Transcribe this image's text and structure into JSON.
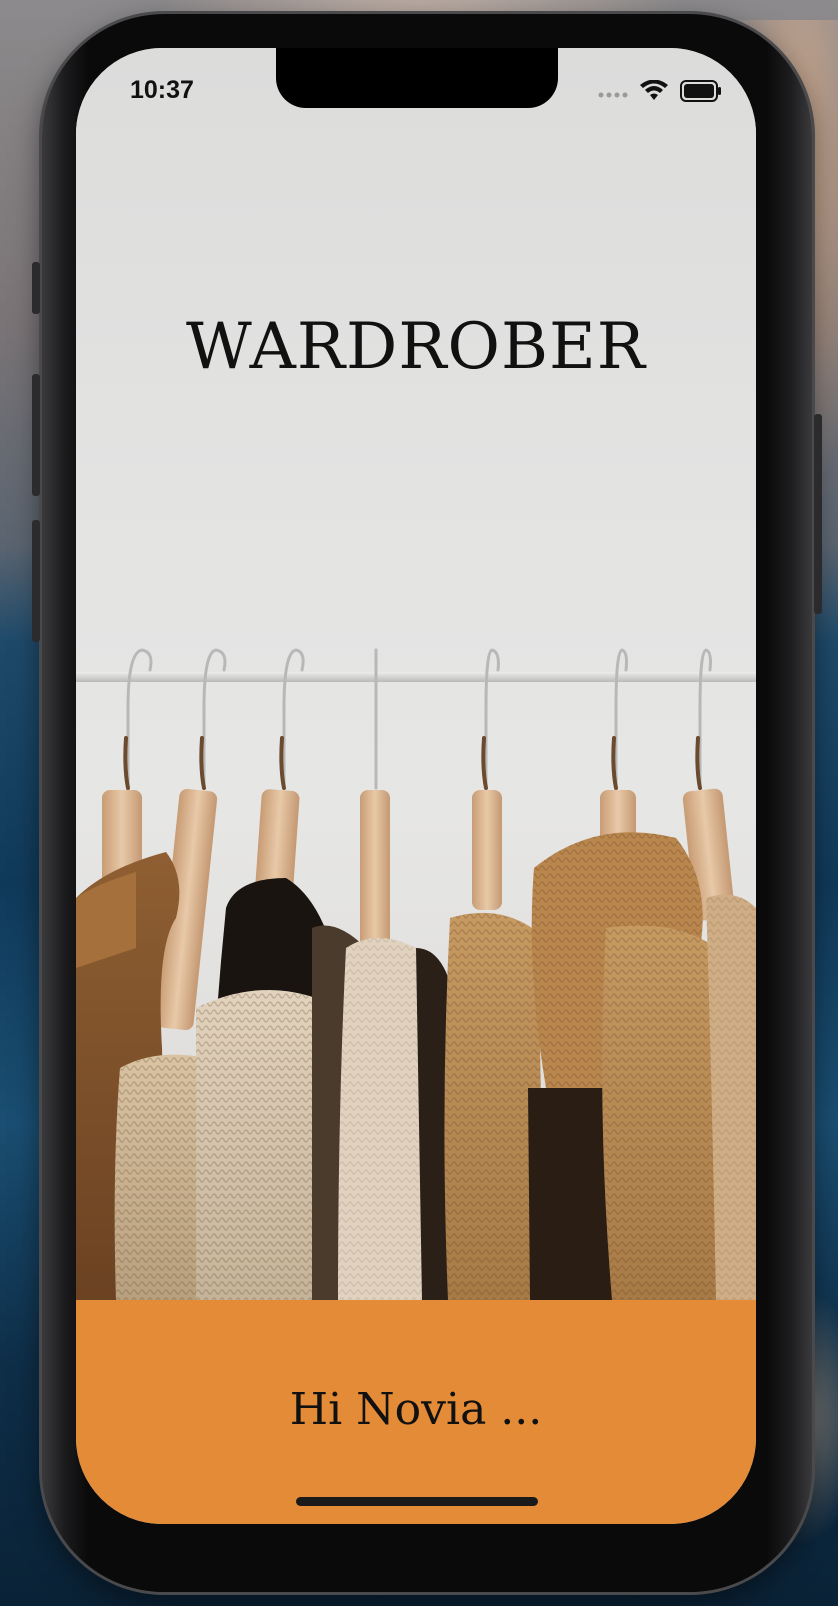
{
  "status_bar": {
    "time": "10:37",
    "signal_icon": "cellular-signal-icon",
    "wifi_icon": "wifi-icon",
    "battery_icon": "battery-icon"
  },
  "app": {
    "title": "WARDROBER",
    "greeting": "Hi Novia ..."
  },
  "colors": {
    "accent": "#e48b37",
    "background": "#dededd",
    "text": "#111111"
  }
}
